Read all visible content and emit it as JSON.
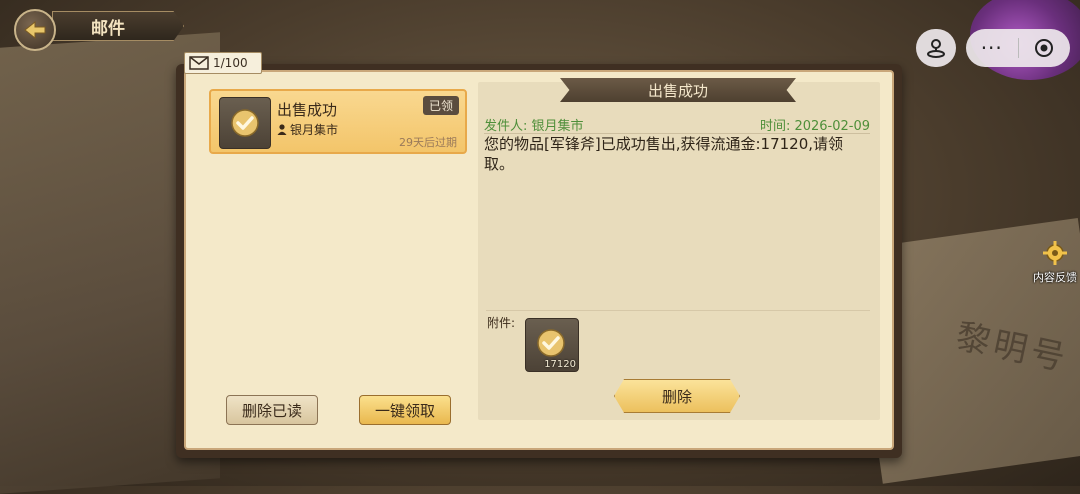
{
  "header": {
    "title": "邮件"
  },
  "mailbox": {
    "count": "1/100"
  },
  "mail_list": [
    {
      "title": "出售成功",
      "sender": "银月集市",
      "badge": "已领",
      "expire": "29天后过期"
    }
  ],
  "detail": {
    "title": "出售成功",
    "sender": "发件人: 银月集市",
    "time": "时间: 2026-02-09",
    "body": "您的物品[军锋斧]已成功售出,获得流通金:17120,请领取。",
    "attachment_label": "附件:",
    "attachment_qty": "17120",
    "delete_label": "删除"
  },
  "actions": {
    "delete_read": "删除已读",
    "claim_all": "一键领取"
  },
  "side": {
    "feedback": "内容反馈",
    "menu_dots": "···"
  },
  "background": {
    "book_title": "黎明号"
  },
  "colors": {
    "accent_gold": "#ecc05d",
    "sender_green": "#4f8f3a",
    "frame_brown": "#3f2f22"
  }
}
